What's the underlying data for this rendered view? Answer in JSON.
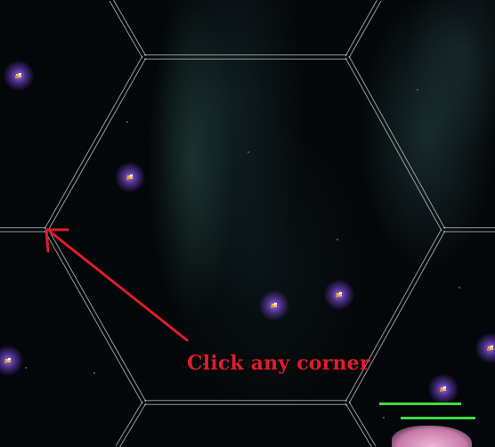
{
  "instruction": {
    "text": "Click any corner",
    "color": "#e11b2a"
  },
  "colors": {
    "arrow": "#e11b2a",
    "grid_lines": "#c8c8c8",
    "health_bar": "#3ddc3d",
    "ship_glow": "#9a66ff"
  },
  "units": {
    "count": 9,
    "icon": "ship-icon"
  },
  "health_bars": {
    "count": 2
  }
}
